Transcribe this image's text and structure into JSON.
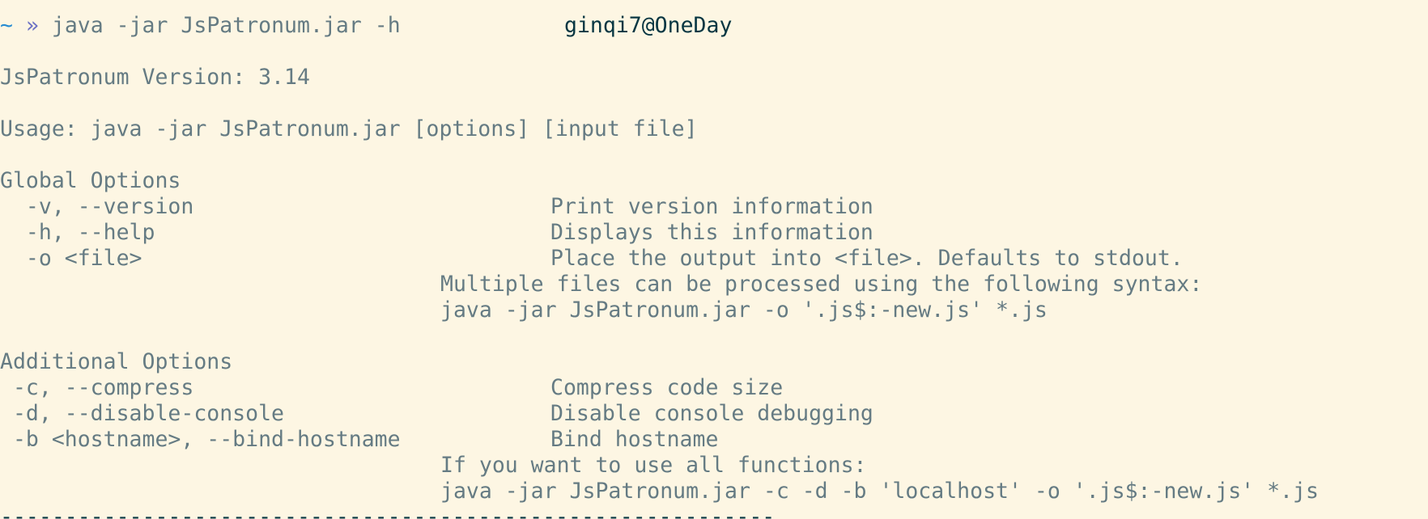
{
  "terminal": {
    "top_rule": "---",
    "prompt": {
      "tilde": "~",
      "chevron": "»",
      "command": "java -jar JsPatronum.jar -h",
      "host": "ginqi7@OneDay"
    },
    "version_line": "JsPatronum Version: 3.14",
    "usage_line": "Usage: java -jar JsPatronum.jar [options] [input file]",
    "global_options": {
      "heading": "Global Options",
      "items": [
        {
          "flag": "  -v, --version",
          "desc": "Print version information"
        },
        {
          "flag": "  -h, --help",
          "desc": "Displays this information"
        },
        {
          "flag": "  -o <file>",
          "desc": "Place the output into <file>. Defaults to stdout."
        }
      ],
      "note_1": "Multiple files can be processed using the following syntax:",
      "note_2": "java -jar JsPatronum.jar -o '.js$:-new.js' *.js"
    },
    "additional_options": {
      "heading": "Additional Options",
      "items": [
        {
          "flag": " -c, --compress",
          "desc": "Compress code size"
        },
        {
          "flag": " -d, --disable-console",
          "desc": "Disable console debugging"
        },
        {
          "flag": " -b <hostname>, --bind-hostname",
          "desc": "Bind hostname"
        }
      ],
      "note_1": "If you want to use all functions:",
      "note_2": "java -jar JsPatronum.jar -c -d -b 'localhost' -o '.js$:-new.js' *.js"
    },
    "bottom_rule": "------------------------------------------------------------"
  }
}
